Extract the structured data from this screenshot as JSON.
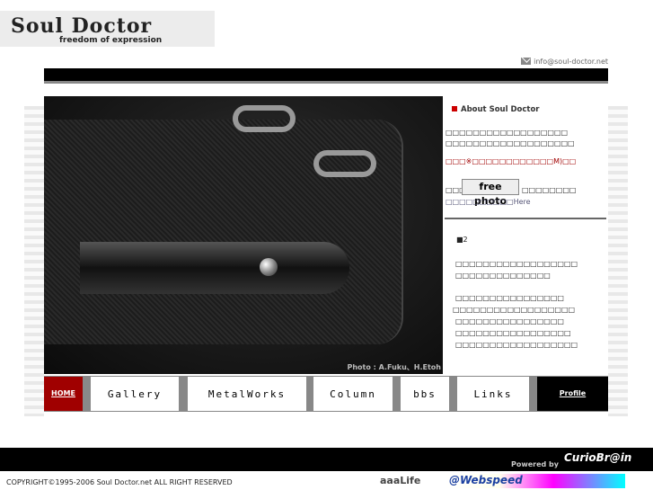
{
  "logo": {
    "title": "Soul Doctor",
    "subtitle": "freedom of expression"
  },
  "header": {
    "email": "info@soul-doctor.net"
  },
  "photo": {
    "caption": "Photo : A.Fuku、H.Etoh"
  },
  "about": {
    "heading": "About Soul Doctor",
    "line1": "□□□□□□□□□□□□□□□□□□",
    "line2": "□□□□□□□□□□□□□□□□□□□",
    "line3": "□□□※□□□□□□□□□□□□M)□□",
    "line4_prefix": "□□□",
    "freephoto": "free photo",
    "line4_suffix": "□□□□□□□□",
    "line5": "□□□□□□□□□□Here",
    "sub_heading": "■2",
    "para1_l1": "□□□□□□□□□□□□□□□□□□",
    "para1_l2": "□□□□□□□□□□□□□□",
    "para2_l1": "□□□□□□□□□□□□□□□□",
    "para2_l2": "□□□□□□□□□□□□□□□□□□",
    "para2_l3": "□□□□□□□□□□□□□□□□",
    "para2_l4": "□□□□□□□□□□□□□□□□□",
    "para2_l5": "□□□□□□□□□□□□□□□□□□"
  },
  "nav": {
    "home": "HOME",
    "gallery": "Gallery",
    "metalworks": "MetalWorks",
    "column": "Column",
    "bbs": "bbs",
    "links": "Links",
    "profile": "Profile"
  },
  "footer": {
    "powered_by": "Powered by",
    "curiobrain": "CurioBr@in",
    "copyright": "COPYRIGHT©1995-2006 Soul Doctor.net  ALL RIGHT RESERVED",
    "aaalife": "aaaLife",
    "webspeed": "@Webspeed"
  },
  "colors": {
    "accent": "#a00000",
    "nav_bg": "#888888",
    "bar": "#000000"
  }
}
